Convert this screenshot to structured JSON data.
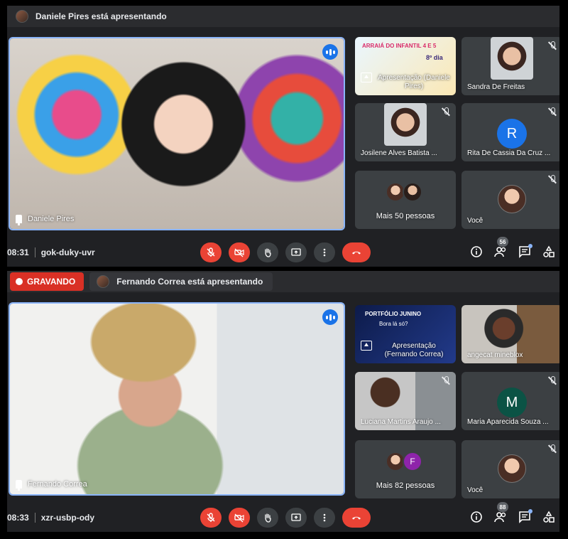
{
  "colors": {
    "background": "#202124",
    "tile": "#3c4043",
    "accent": "#1a73e8",
    "danger": "#ea4335",
    "recording": "#d93025",
    "avatar_blue": "#1a73e8",
    "avatar_green": "#0b5345",
    "avatar_purple": "#8e24aa"
  },
  "meetings": [
    {
      "presenter_banner": "Daniele Pires está apresentando",
      "main_speaker": "Daniele Pires",
      "tiles": [
        {
          "label": "Apresentação (Daniele Pires)",
          "type": "presentation",
          "title": "ARRAIÁ DO INFANTIL 4 E 5",
          "subtitle": "8º dia"
        },
        {
          "label": "Sandra De Freitas",
          "type": "video",
          "muted": true
        },
        {
          "label": "Josilene Alves Batista ...",
          "type": "video",
          "muted": true
        },
        {
          "label": "Rita De Cassia Da Cruz ...",
          "type": "letter",
          "letter": "R",
          "muted": true
        },
        {
          "label": "Mais 50 pessoas",
          "type": "more"
        },
        {
          "label": "Você",
          "type": "self",
          "muted": true
        }
      ],
      "time": "08:31",
      "meeting_code": "gok-duky-uvr",
      "participant_count": "56"
    },
    {
      "recording_label": "GRAVANDO",
      "presenter_banner": "Fernando Correa está apresentando",
      "main_speaker": "Fernando Correa",
      "tiles": [
        {
          "label": "Apresentação (Fernando Correa)",
          "type": "presentation",
          "title": "PORTFÓLIO JUNINO",
          "subtitle": "Bora lá só?"
        },
        {
          "label": "angecat mineblox",
          "type": "video"
        },
        {
          "label": "Luciana Martins Araujo ...",
          "type": "video",
          "muted": true
        },
        {
          "label": "Maria Aparecida Souza ...",
          "type": "letter",
          "letter": "M",
          "muted": true
        },
        {
          "label": "Mais 82 pessoas",
          "type": "more",
          "letter": "F"
        },
        {
          "label": "Você",
          "type": "self",
          "muted": true
        }
      ],
      "time": "08:33",
      "meeting_code": "xzr-usbp-ody",
      "participant_count": "88"
    }
  ],
  "icons": {
    "mic_off": "mic-off-icon",
    "cam_off": "camera-off-icon",
    "hand": "raise-hand-icon",
    "present": "present-screen-icon",
    "more": "more-options-icon",
    "end": "end-call-icon",
    "info": "info-icon",
    "people": "people-icon",
    "chat": "chat-icon",
    "activities": "activities-icon"
  }
}
